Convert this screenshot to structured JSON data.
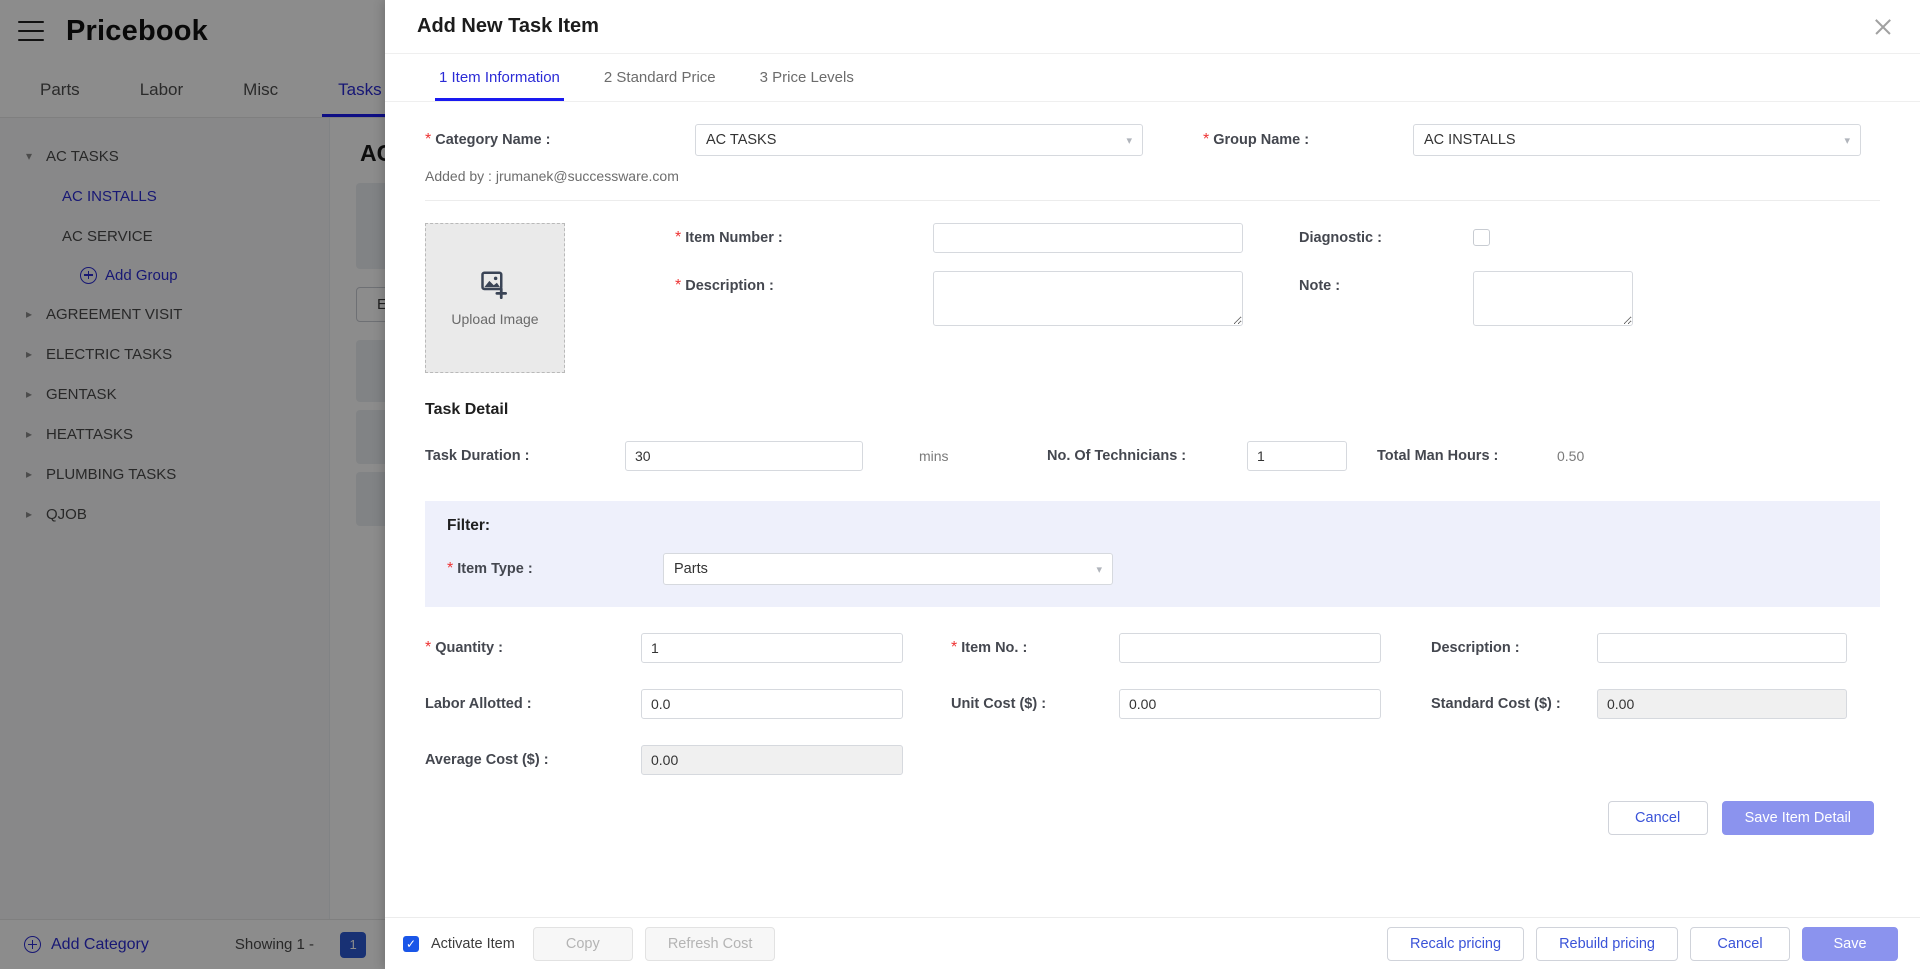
{
  "app": {
    "title": "Pricebook",
    "menu_icon": "hamburger-icon",
    "tabs": [
      {
        "label": "Parts",
        "active": false
      },
      {
        "label": "Labor",
        "active": false
      },
      {
        "label": "Misc",
        "active": false
      },
      {
        "label": "Tasks",
        "active": true
      }
    ],
    "tree": [
      {
        "label": "AC TASKS",
        "level": 0,
        "expanded": true
      },
      {
        "label": "AC INSTALLS",
        "level": 1,
        "selected": true
      },
      {
        "label": "AC SERVICE",
        "level": 1,
        "selected": false
      },
      {
        "label": "AGREEMENT VISIT",
        "level": 0,
        "expanded": false
      },
      {
        "label": "ELECTRIC TASKS",
        "level": 0,
        "expanded": false
      },
      {
        "label": "GENTASK",
        "level": 0,
        "expanded": false
      },
      {
        "label": "HEATTASKS",
        "level": 0,
        "expanded": false
      },
      {
        "label": "PLUMBING TASKS",
        "level": 0,
        "expanded": false
      },
      {
        "label": "QJOB",
        "level": 0,
        "expanded": false
      }
    ],
    "add_group_label": "Add Group",
    "content_title": "AC TASKS",
    "export_label": "Export",
    "add_category_label": "Add Category",
    "showing_text": "Showing 1 -",
    "page_number": "1"
  },
  "modal": {
    "title": "Add New Task Item",
    "close_icon": "close-icon",
    "tabs": [
      {
        "label": "1 Item Information",
        "active": true
      },
      {
        "label": "2 Standard Price",
        "active": false
      },
      {
        "label": "3 Price Levels",
        "active": false
      }
    ],
    "category_label": "Category Name :",
    "category_value": "AC TASKS",
    "group_label": "Group Name :",
    "group_value": "AC INSTALLS",
    "added_by": "Added by : jrumanek@successware.com",
    "upload_label": "Upload Image",
    "item_number_label": "Item Number :",
    "item_number_value": "",
    "description_label": "Description :",
    "description_value": "",
    "diagnostic_label": "Diagnostic :",
    "diagnostic_checked": false,
    "note_label": "Note :",
    "note_value": "",
    "task_detail_title": "Task Detail",
    "task_duration_label": "Task Duration :",
    "task_duration_value": "30",
    "mins_label": "mins",
    "technicians_label": "No. Of Technicians :",
    "technicians_value": "1",
    "total_man_hours_label": "Total Man Hours :",
    "total_man_hours_value": "0.50",
    "filter_title": "Filter:",
    "item_type_label": "Item Type :",
    "item_type_value": "Parts",
    "quantity_label": "Quantity :",
    "quantity_value": "1",
    "item_no_label": "Item No. :",
    "item_no_value": "",
    "desc2_label": "Description :",
    "desc2_value": "",
    "labor_allotted_label": "Labor Allotted :",
    "labor_allotted_value": "0.0",
    "unit_cost_label": "Unit Cost ($) :",
    "unit_cost_value": "0.00",
    "standard_cost_label": "Standard Cost ($) :",
    "standard_cost_value": "0.00",
    "average_cost_label": "Average Cost ($) :",
    "average_cost_value": "0.00",
    "inline_cancel_label": "Cancel",
    "save_item_detail_label": "Save Item Detail",
    "activate_item_label": "Activate Item",
    "activate_item_checked": true,
    "copy_label": "Copy",
    "refresh_cost_label": "Refresh Cost",
    "recalc_pricing_label": "Recalc pricing",
    "rebuild_pricing_label": "Rebuild pricing",
    "cancel_label": "Cancel",
    "save_label": "Save"
  },
  "colors": {
    "accent_blue": "#1a1af0",
    "link_blue": "#2c2cd4",
    "primary_button": "#8b93ee",
    "filter_bg": "#eef0fb",
    "required_red": "#e33333"
  }
}
